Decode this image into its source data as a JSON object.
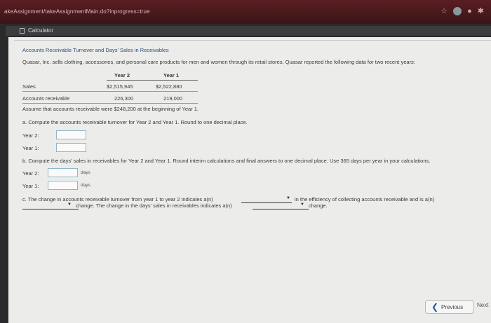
{
  "browser": {
    "url": "akeAssignment/takeAssignmentMain.do?inprogress=true",
    "icons": [
      "star-icon",
      "extension-icon",
      "profile-icon",
      "bolt-icon"
    ]
  },
  "calculator": {
    "label": "Calculator"
  },
  "problem": {
    "title": "Accounts Receivable Turnover and Days' Sales in Receivables",
    "intro": "Quasar, Inc. sells clothing, accessories, and personal care products for men and women through its retail stores. Quasar reported the following data for two recent years:",
    "table": {
      "headers": [
        "Year 2",
        "Year 1"
      ],
      "rows": [
        {
          "label": "Sales",
          "year2": "$2,515,945",
          "year1": "$2,522,880"
        },
        {
          "label": "Accounts receivable",
          "year2": "226,300",
          "year1": "219,000"
        }
      ]
    },
    "assumption": "Assume that accounts receivable were $248,200 at the beginning of Year 1."
  },
  "part_a": {
    "prompt": "a.  Compute the accounts receivable turnover for Year 2 and Year 1. Round to one decimal place.",
    "rows": [
      {
        "label": "Year 2:",
        "value": ""
      },
      {
        "label": "Year 1:",
        "value": ""
      }
    ]
  },
  "part_b": {
    "prompt": "b.  Compute the days' sales in receivables for Year 2 and Year 1. Round interim calculations and final answers to one decimal place. Use 365 days per year in your calculations.",
    "rows": [
      {
        "label": "Year 2:",
        "value": "",
        "unit": "days"
      },
      {
        "label": "Year 1:",
        "value": "",
        "unit": "days"
      }
    ]
  },
  "part_c": {
    "line1_a": "c.  The change in accounts receivable turnover from year 1 to year 2 indicates a(n)",
    "line1_b": "in the efficiency of collecting accounts receivable and is a(n)",
    "line2_a": "change. The change in the days' sales in receivables indicates a(n)",
    "line2_b": "change.",
    "dropdown1": "",
    "dropdown2": "",
    "dropdown3": ""
  },
  "nav": {
    "previous": "Previous",
    "next": "Next"
  }
}
